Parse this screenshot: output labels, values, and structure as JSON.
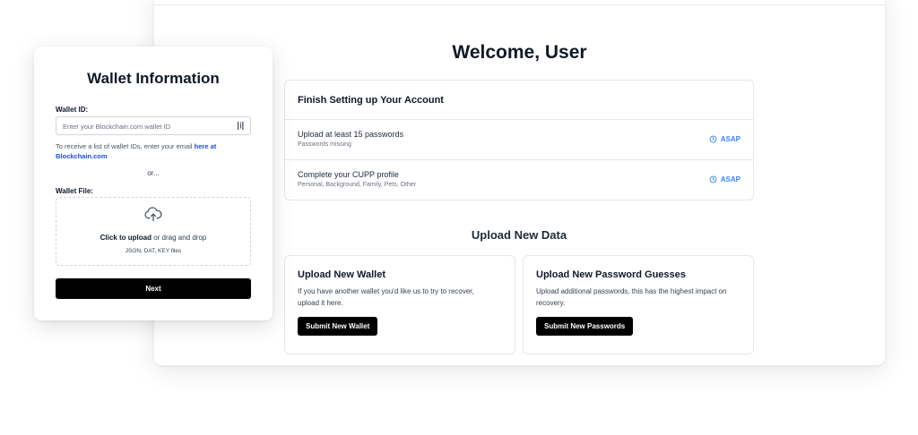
{
  "dashboard": {
    "welcome": "Welcome, User",
    "setup": {
      "title": "Finish Setting up Your Account",
      "rows": [
        {
          "title": "Upload at least 15 passwords",
          "subtitle": "Passwords missing",
          "status": "ASAP",
          "status_icon": "clock-icon"
        },
        {
          "title": "Complete your CUPP profile",
          "subtitle": "Personal, Background, Family, Pets, Other",
          "status": "ASAP",
          "status_icon": "clock-icon"
        }
      ]
    },
    "upload_heading": "Upload New Data",
    "cards": [
      {
        "title": "Upload New Wallet",
        "description": "If you have another wallet you'd like us to try to recover, upload it here.",
        "button": "Submit New Wallet"
      },
      {
        "title": "Upload New Password Guesses",
        "description": "Upload additional passwords, this has the highest impact on recovery.",
        "button": "Submit New Passwords"
      }
    ]
  },
  "wallet_form": {
    "title": "Wallet Information",
    "wallet_id_label": "Wallet ID:",
    "wallet_id_placeholder": "Enter your Blockchain.com wallet ID",
    "wallet_id_value": "",
    "hint_text": "To receive a list of wallet IDs, enter your email ",
    "hint_link": "here at Blockchain.com",
    "or_text": "or...",
    "wallet_file_label": "Wallet File:",
    "drop_strong": "Click to upload",
    "drop_rest": " or drag and drop",
    "drop_formats": "JSON, DAT, KEY files",
    "next_button": "Next",
    "icons": {
      "scan": "scan-icon",
      "upload": "cloud-upload-icon"
    }
  },
  "colors": {
    "accent": "#3b82f6",
    "link": "#1d4ed8",
    "button": "#000000"
  }
}
